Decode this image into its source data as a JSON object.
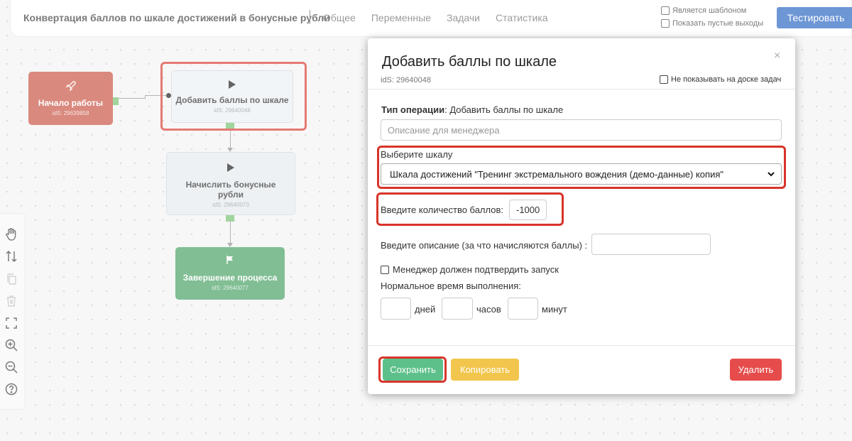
{
  "header": {
    "title": "Конвертация баллов по шкале достижений в бонусные рубли",
    "nav": [
      "Общее",
      "Переменные",
      "Задачи",
      "Статистика"
    ],
    "template_checkbox": "Является шаблоном",
    "empty_outputs_checkbox": "Показать пустые выходы",
    "test_button": "Тестировать"
  },
  "nodes": {
    "start": {
      "title": "Начало работы",
      "id": "idS: 29639858"
    },
    "add": {
      "title": "Добавить баллы по шкале",
      "id": "idS: 29640048"
    },
    "credit": {
      "title": "Начислить бонусные рубли",
      "id": "idS: 29640073"
    },
    "end": {
      "title": "Завершение процесса",
      "id": "idS: 29640077"
    }
  },
  "toolbar": [
    "hand-icon",
    "swap-vertical-icon",
    "copy-icon",
    "trash-icon",
    "fit-screen-icon",
    "zoom-in-icon",
    "zoom-out-icon",
    "help-icon"
  ],
  "modal": {
    "title": "Добавить баллы по шкале",
    "close": "×",
    "ids": "idS: 29640048",
    "hide_checkbox": "Не показывать на доске задач",
    "operation_label": "Тип операции",
    "operation_value": "Добавить баллы по шкале",
    "manager_desc_placeholder": "Описание для менеджера",
    "scale_label": "Выберите шкалу",
    "scale_value": "Шкала достижений \"Тренинг экстремального вождения (демо-данные) копия\"",
    "points_label": "Введите количество баллов:",
    "points_value": "-1000",
    "desc_label": "Введите описание (за что начисляются баллы) :",
    "confirm_checkbox": "Менеджер должен подтвердить запуск",
    "normal_time_label": "Нормальное время выполнения:",
    "days_label": "дней",
    "hours_label": "часов",
    "minutes_label": "минут",
    "save_button": "Сохранить",
    "copy_button": "Копировать",
    "delete_button": "Удалить"
  },
  "colors": {
    "highlight": "#d8342a",
    "test_button": "#1f5fbf",
    "save": "#5dc08a",
    "copy": "#f2c64c",
    "delete": "#e74c4c"
  }
}
